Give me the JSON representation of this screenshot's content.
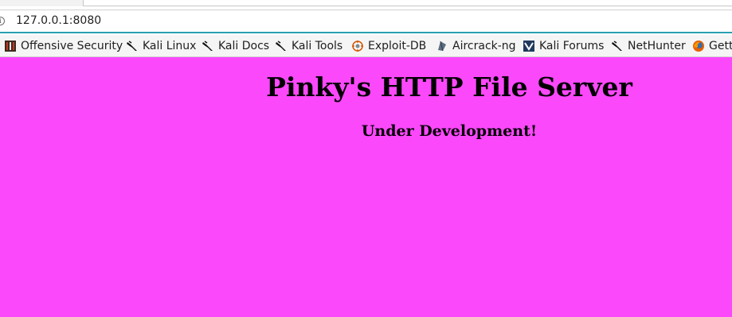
{
  "browser": {
    "url": "127.0.0.1:8080",
    "accent_color": "#28a0b0"
  },
  "bookmarks": [
    {
      "label": "Offensive Security",
      "icon": "offensive-security-icon"
    },
    {
      "label": "Kali Linux",
      "icon": "kali-dragon-icon"
    },
    {
      "label": "Kali Docs",
      "icon": "kali-dragon-icon"
    },
    {
      "label": "Kali Tools",
      "icon": "kali-dragon-icon"
    },
    {
      "label": "Exploit-DB",
      "icon": "exploit-db-icon"
    },
    {
      "label": "Aircrack-ng",
      "icon": "aircrack-ng-icon"
    },
    {
      "label": "Kali Forums",
      "icon": "kali-forums-icon"
    },
    {
      "label": "NetHunter",
      "icon": "kali-dragon-icon"
    },
    {
      "label": "Gett",
      "icon": "firefox-icon"
    }
  ],
  "page": {
    "title": "Pinky's HTTP File Server",
    "subtitle": "Under Development!",
    "background_color": "#fa48fa"
  }
}
